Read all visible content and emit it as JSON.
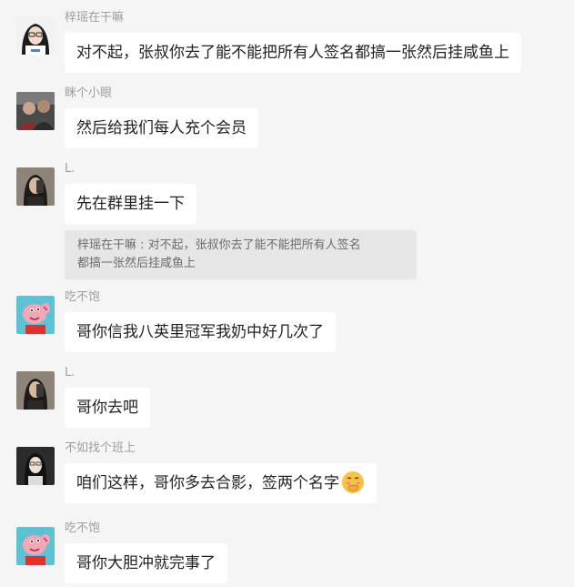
{
  "messages": [
    {
      "sender": "梓瑶在干嘛",
      "text": "对不起，张叔你去了能不能把所有人签名都搞一张然后挂咸鱼上",
      "avatar": "avatar-girl-glasses-icon"
    },
    {
      "sender": "眯个小眼",
      "text": "然后给我们每人充个会员",
      "avatar": "avatar-people-photo-icon"
    },
    {
      "sender": "L.",
      "text": "先在群里挂一下",
      "avatar": "avatar-mirror-selfie-icon"
    },
    {
      "sender": "吃不饱",
      "text": "哥你信我八英里冠军我奶中好几次了",
      "avatar": "avatar-peppa-pig-icon"
    },
    {
      "sender": "L.",
      "text": "哥你去吧",
      "avatar": "avatar-mirror-selfie-icon"
    },
    {
      "sender": "不如找个班上",
      "text": "咱们这样，哥你多去合影，签两个名字",
      "avatar": "avatar-girl-selfie-icon",
      "emoji": "face-with-hand-over-mouth-emoji"
    },
    {
      "sender": "吃不饱",
      "text": "哥你大胆冲就完事了",
      "avatar": "avatar-peppa-pig-icon"
    }
  ],
  "quote": {
    "line1": "梓瑶在干嘛 : 对不起，张叔你去了能不能把所有人签名",
    "line2": "都搞一张然后挂咸鱼上"
  },
  "colors": {
    "background": "#f5f5f5",
    "bubble": "#ffffff",
    "quote_background": "#e6e6e6",
    "sender_name": "#9e9e9e",
    "peppa_pink": "#f4a6b5"
  }
}
